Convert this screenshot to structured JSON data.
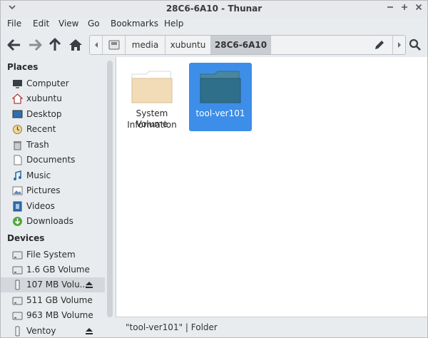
{
  "window": {
    "title": "28C6-6A10 - Thunar"
  },
  "menubar": [
    "File",
    "Edit",
    "View",
    "Go",
    "Bookmarks",
    "Help"
  ],
  "toolbar": {
    "path": [
      "media",
      "xubuntu",
      "28C6-6A10"
    ]
  },
  "sidebar": {
    "places_header": "Places",
    "places": [
      {
        "label": "Computer",
        "icon": "computer-icon"
      },
      {
        "label": "xubuntu",
        "icon": "home-icon"
      },
      {
        "label": "Desktop",
        "icon": "desktop-icon"
      },
      {
        "label": "Recent",
        "icon": "recent-icon"
      },
      {
        "label": "Trash",
        "icon": "trash-icon"
      },
      {
        "label": "Documents",
        "icon": "documents-icon"
      },
      {
        "label": "Music",
        "icon": "music-icon"
      },
      {
        "label": "Pictures",
        "icon": "pictures-icon"
      },
      {
        "label": "Videos",
        "icon": "videos-icon"
      },
      {
        "label": "Downloads",
        "icon": "downloads-icon"
      }
    ],
    "devices_header": "Devices",
    "devices": [
      {
        "label": "File System",
        "icon": "drive-icon",
        "eject": false
      },
      {
        "label": "1.6 GB Volume",
        "icon": "drive-icon",
        "eject": false
      },
      {
        "label": "107 MB Volu...",
        "icon": "usb-drive-icon",
        "eject": true,
        "selected": true
      },
      {
        "label": "511 GB Volume",
        "icon": "drive-icon",
        "eject": false
      },
      {
        "label": "963 MB Volume",
        "icon": "drive-icon",
        "eject": false
      },
      {
        "label": "Ventoy",
        "icon": "usb-drive-icon",
        "eject": true
      }
    ]
  },
  "files": [
    {
      "name_line1": "System Volume",
      "name_line2": "Information",
      "selected": false
    },
    {
      "name_line1": "tool-ver101",
      "name_line2": "",
      "selected": true
    }
  ],
  "statusbar": {
    "text": "\"tool-ver101\"  |  Folder"
  },
  "colors": {
    "selection": "#3d8ee8",
    "folder_light": "#f2dcb8",
    "folder_blue": "#2f6f8a"
  }
}
